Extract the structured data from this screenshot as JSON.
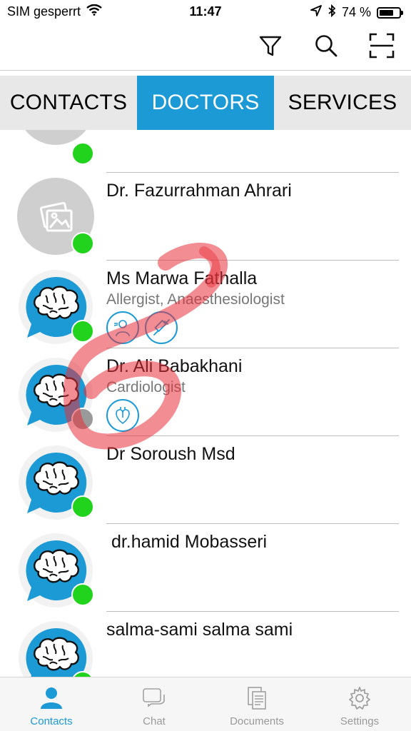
{
  "status_bar": {
    "carrier": "SIM gesperrt",
    "time": "11:47",
    "battery_text": "74 %",
    "battery_level": 0.74,
    "wifi_icon": "wifi-icon",
    "location_icon": "location-arrow-icon",
    "bluetooth_icon": "bluetooth-icon"
  },
  "toolbar": {
    "filter_icon": "filter-icon",
    "search_icon": "search-icon",
    "scan_icon": "scan-icon"
  },
  "tabs": [
    {
      "label": "CONTACTS",
      "active": false
    },
    {
      "label": "DOCTORS",
      "active": true
    },
    {
      "label": "SERVICES",
      "active": false
    }
  ],
  "contacts": [
    {
      "name": "",
      "specialty": "",
      "avatar": "placeholder-photo-icon",
      "status": "online",
      "spec_icons": []
    },
    {
      "name": "Dr. Fazurrahman Ahrari",
      "specialty": "",
      "avatar": "placeholder-photo-icon",
      "status": "online",
      "spec_icons": []
    },
    {
      "name": "Ms Marwa Fathalla",
      "specialty": "Allergist, Anaesthesiologist",
      "avatar": "brain-chat-icon",
      "status": "online",
      "spec_icons": [
        "allergist-icon",
        "syringe-icon"
      ]
    },
    {
      "name": "Dr. Ali Babakhani",
      "specialty": "Cardiologist",
      "avatar": "brain-chat-icon",
      "status": "offline",
      "spec_icons": [
        "heart-icon"
      ]
    },
    {
      "name": "Dr Soroush Msd",
      "specialty": "",
      "avatar": "brain-chat-icon",
      "status": "online",
      "spec_icons": []
    },
    {
      "name": " dr.hamid Mobasseri",
      "specialty": "",
      "avatar": "brain-chat-icon",
      "status": "online",
      "spec_icons": []
    },
    {
      "name": "salma-sami salma sami",
      "specialty": "",
      "avatar": "brain-chat-icon",
      "status": "online",
      "spec_icons": []
    }
  ],
  "bottom_nav": [
    {
      "label": "Contacts",
      "icon": "person-icon",
      "active": true
    },
    {
      "label": "Chat",
      "icon": "chat-icon",
      "active": false
    },
    {
      "label": "Documents",
      "icon": "documents-icon",
      "active": false
    },
    {
      "label": "Settings",
      "icon": "gear-icon",
      "active": false
    }
  ],
  "colors": {
    "accent": "#1c9ad6",
    "online": "#22d31d",
    "offline": "#9a9a9a",
    "tab_bg": "#e8e8e8"
  }
}
